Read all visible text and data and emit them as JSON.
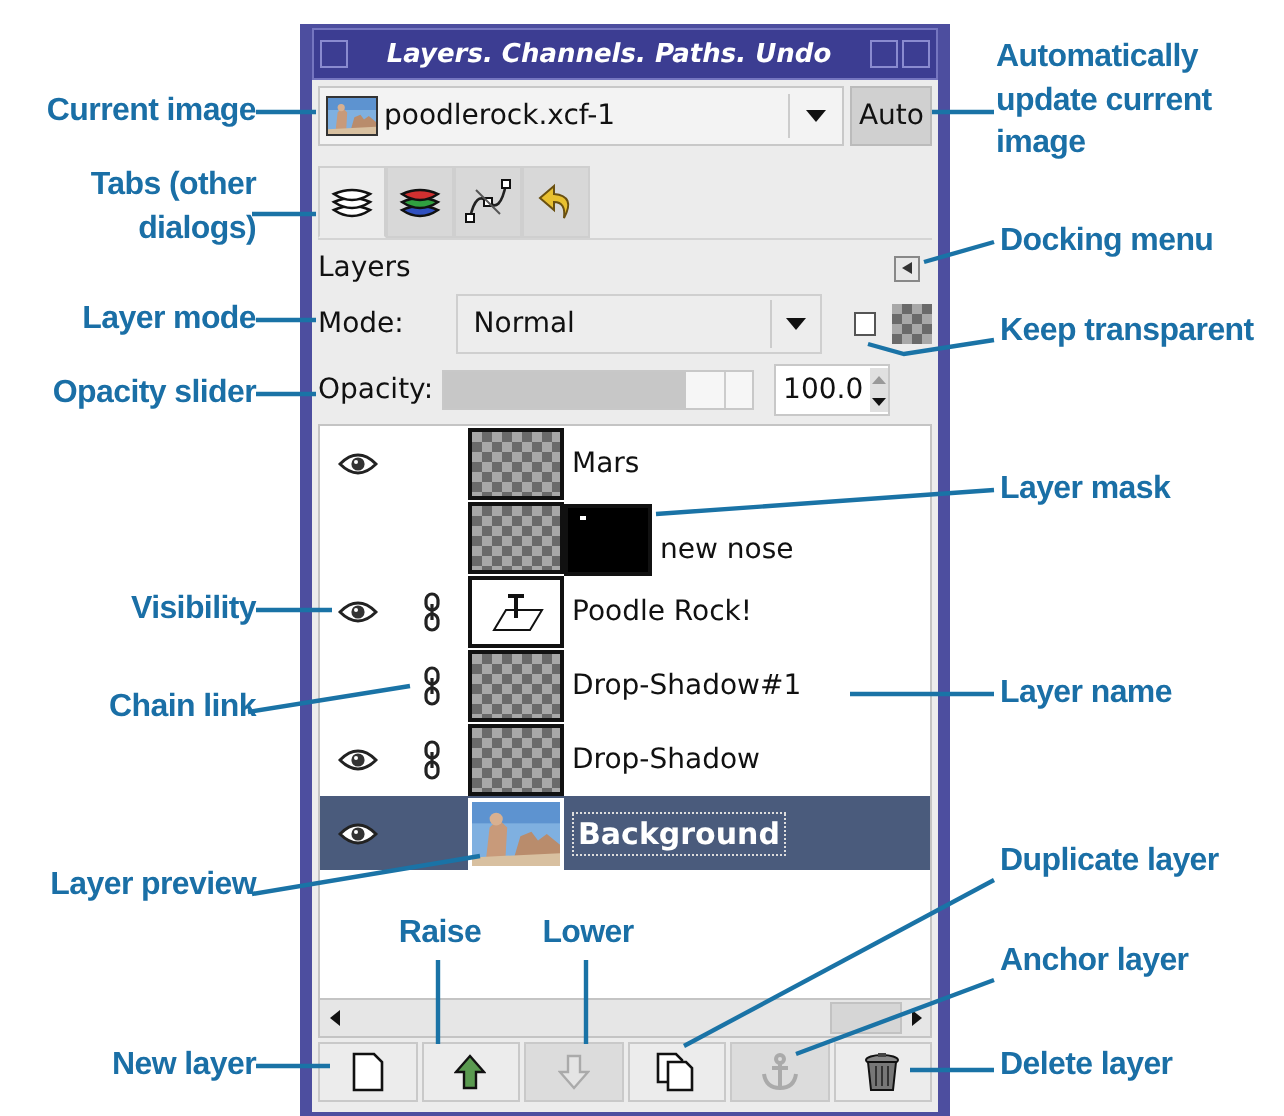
{
  "window": {
    "title": "Layers. Channels. Paths. Undo"
  },
  "image_selector": {
    "name": "poodlerock.xcf-1",
    "auto_button": "Auto"
  },
  "tabs": [
    {
      "kind": "layers",
      "selected": true
    },
    {
      "kind": "channels",
      "selected": false
    },
    {
      "kind": "paths",
      "selected": false
    },
    {
      "kind": "undo",
      "selected": false
    }
  ],
  "section_title": "Layers",
  "mode": {
    "label": "Mode:",
    "value": "Normal"
  },
  "keep_transparent": {
    "checked": false
  },
  "opacity": {
    "label": "Opacity:",
    "level": 0.79,
    "value": "100.0"
  },
  "layers": [
    {
      "name": "Mars",
      "visible": true,
      "linked": false,
      "kind": "transparent",
      "mask": false,
      "selected": false
    },
    {
      "name": "new nose",
      "visible": false,
      "linked": false,
      "kind": "transparent",
      "mask": true,
      "selected": false
    },
    {
      "name": "Poodle Rock!",
      "visible": true,
      "linked": true,
      "kind": "text",
      "mask": false,
      "selected": false
    },
    {
      "name": "Drop-Shadow#1",
      "visible": false,
      "linked": true,
      "kind": "transparent",
      "mask": false,
      "selected": false
    },
    {
      "name": "Drop-Shadow",
      "visible": true,
      "linked": true,
      "kind": "transparent",
      "mask": false,
      "selected": false
    },
    {
      "name": "Background",
      "visible": true,
      "linked": false,
      "kind": "picture",
      "mask": false,
      "selected": true
    }
  ],
  "buttons": [
    {
      "kind": "new",
      "disabled": false
    },
    {
      "kind": "raise",
      "disabled": false
    },
    {
      "kind": "lower",
      "disabled": true
    },
    {
      "kind": "duplicate",
      "disabled": false
    },
    {
      "kind": "anchor",
      "disabled": true
    },
    {
      "kind": "delete",
      "disabled": false
    }
  ],
  "callouts": [
    {
      "text": "Current image"
    },
    {
      "text": "Tabs (other dialogs)"
    },
    {
      "text": "Layer mode"
    },
    {
      "text": "Opacity slider"
    },
    {
      "text": "Visibility"
    },
    {
      "text": "Chain link"
    },
    {
      "text": "Layer preview"
    },
    {
      "text": "New layer"
    },
    {
      "text": "Raise"
    },
    {
      "text": "Lower"
    },
    {
      "text": "Automatically update current image"
    },
    {
      "text": "Docking menu"
    },
    {
      "text": "Keep transparent"
    },
    {
      "text": "Layer mask"
    },
    {
      "text": "Layer name"
    },
    {
      "text": "Duplicate layer"
    },
    {
      "text": "Anchor layer"
    },
    {
      "text": "Delete layer"
    }
  ]
}
